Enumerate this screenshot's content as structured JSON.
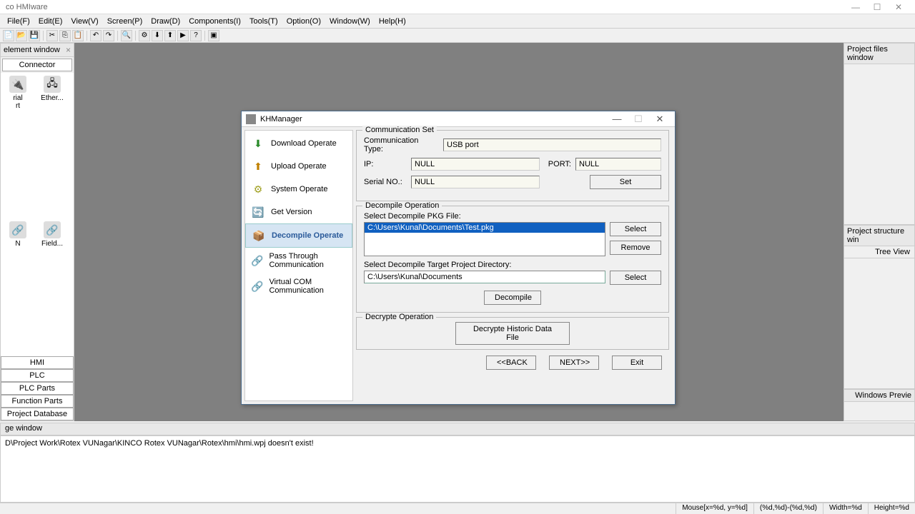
{
  "app": {
    "title": "co HMIware"
  },
  "menu": {
    "file": "File(F)",
    "edit": "Edit(E)",
    "view": "View(V)",
    "screen": "Screen(P)",
    "draw": "Draw(D)",
    "components": "Components(I)",
    "tools": "Tools(T)",
    "option": "Option(O)",
    "window": "Window(W)",
    "help": "Help(H)"
  },
  "leftPanel": {
    "title": "element window",
    "tab": "Connector",
    "items": {
      "rial": "rial",
      "rt": "rt",
      "ether": "Ether...",
      "n": "N",
      "field": "Field..."
    },
    "cats": {
      "hmi": "HMI",
      "plc": "PLC",
      "plcparts": "PLC Parts",
      "funcparts": "Function Parts",
      "projdb": "Project Database"
    }
  },
  "rightPanel1": {
    "title": "Project files window"
  },
  "rightPanel2": {
    "title": "Project structure win",
    "tree": "Tree View"
  },
  "rightPanel3": {
    "title": "Windows Previe"
  },
  "messagePanel": {
    "title": "ge window",
    "text": "D\\Project Work\\Rotex VUNagar\\KINCO Rotex VUNagar\\Rotex\\hmi\\hmi.wpj doesn't exist!"
  },
  "status": {
    "mouse": "Mouse[x=%d, y=%d]",
    "rect": "(%d,%d)-(%d,%d)",
    "width": "Width=%d",
    "height": "Height=%d"
  },
  "dialog": {
    "title": "KHManager",
    "nav": {
      "download": "Download Operate",
      "upload": "Upload Operate",
      "system": "System Operate",
      "getver": "Get Version",
      "decompile": "Decompile Operate",
      "passthrough": "Pass Through Communication",
      "vcom": "Virtual COM Communication"
    },
    "comm": {
      "legend": "Communication Set",
      "type_label": "Communication Type:",
      "type_value": "USB port",
      "ip_label": "IP:",
      "ip_value": "NULL",
      "port_label": "PORT:",
      "port_value": "NULL",
      "serial_label": "Serial NO.:",
      "serial_value": "NULL",
      "set_btn": "Set"
    },
    "decomp": {
      "legend": "Decompile Operation",
      "pkg_label": "Select Decompile PKG File:",
      "pkg_selected": "C:\\Users\\Kunal\\Documents\\Test.pkg",
      "dir_label": "Select Decompile Target Project Directory:",
      "dir_value": "C:\\Users\\Kunal\\Documents",
      "select_btn": "Select",
      "remove_btn": "Remove",
      "decompile_btn": "Decompile"
    },
    "decrypt": {
      "legend": "Decrypte Operation",
      "btn": "Decrypte Historic Data File"
    },
    "back": "<<BACK",
    "next": "NEXT>>",
    "exit": "Exit"
  }
}
